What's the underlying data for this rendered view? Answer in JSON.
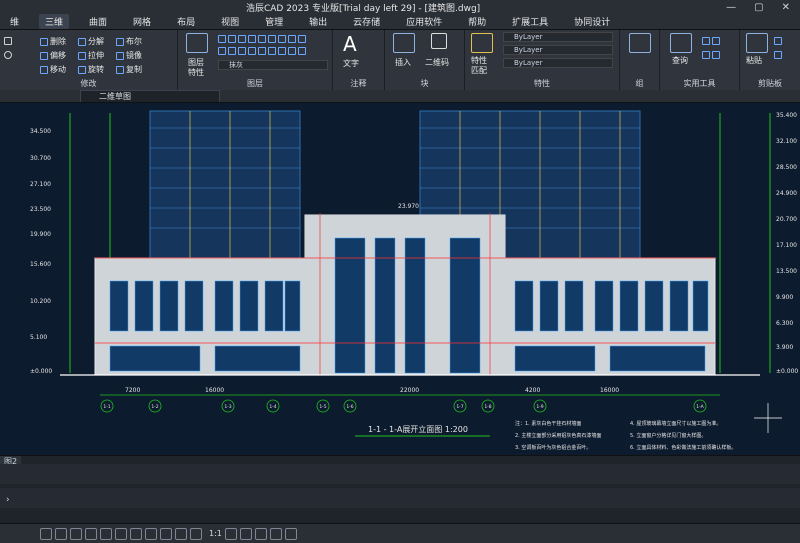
{
  "window": {
    "title": "浩辰CAD 2023 专业版[Trial day left 29] - [建筑图.dwg]",
    "controls": [
      "—",
      "▢",
      "✕"
    ]
  },
  "menu": {
    "items": [
      "三维",
      "曲面",
      "网格",
      "布局",
      "视图",
      "管理",
      "输出",
      "云存储",
      "应用软件",
      "帮助",
      "扩展工具",
      "协同设计"
    ],
    "left_label": "维"
  },
  "ribbon": {
    "modify": {
      "label": "修改",
      "items": [
        "删除",
        "分解",
        "布尔",
        "偏移",
        "拉伸",
        "镜像",
        "移动",
        "旋转",
        "复制"
      ]
    },
    "layers": {
      "label": "图层",
      "property_label": "图层",
      "property_label2": "特性",
      "layer_value": "抹灰"
    },
    "annotation": {
      "label": "注释",
      "text_label": "文字"
    },
    "block": {
      "label": "块",
      "insert_label": "插入",
      "qrcode_label": "二维码"
    },
    "properties": {
      "label": "特性",
      "match_label": "特性",
      "match_label2": "匹配",
      "bylayer1": "ByLayer",
      "bylayer2": "ByLayer",
      "bylayer3": "ByLayer"
    },
    "group": {
      "label": "组"
    },
    "utilities": {
      "label": "实用工具",
      "query_label": "查询"
    },
    "clipboard": {
      "label": "剪贴板",
      "paste_label": "粘贴"
    }
  },
  "tab": {
    "label": "二维草图"
  },
  "drawing": {
    "title": "1-1 - 1-A展开立面图 1:200",
    "left_elevations": [
      "34.500",
      "30.700",
      "27.100",
      "23.500",
      "19.900",
      "15.600",
      "10.200",
      "5.100",
      "±0.000"
    ],
    "right_elevations": [
      "35.400",
      "32.100",
      "28.500",
      "24.900",
      "20.700",
      "17.100",
      "13.500",
      "9.900",
      "6.300",
      "3.900",
      "±0.000"
    ],
    "axis_labels": [
      "1-1",
      "1-2",
      "1-3",
      "1-4",
      "1-5",
      "1-6",
      "1-7",
      "1-8",
      "1-9",
      "1-A"
    ],
    "dims": [
      "7200",
      "16000",
      "22000",
      "4200",
      "16000"
    ],
    "notes": [
      "注：1. 素灰白色干挂石材墙面",
      "2. 主楼立面部分采用铝灰色真石漆墙面",
      "3. 空调板百叶为灰色铝合金百叶。",
      "4. 屋顶玻璃幕墙立面尺寸以施工图为准。",
      "5. 立面窗户分格详见门窗大样图。",
      "6. 立面具体材料、色彩做法施工前须确认样板。"
    ],
    "top_mark": "23.970"
  },
  "layout_tab": "图2",
  "command": {
    "prompt_arrow": "›"
  },
  "status": {
    "scale": "1:1"
  }
}
